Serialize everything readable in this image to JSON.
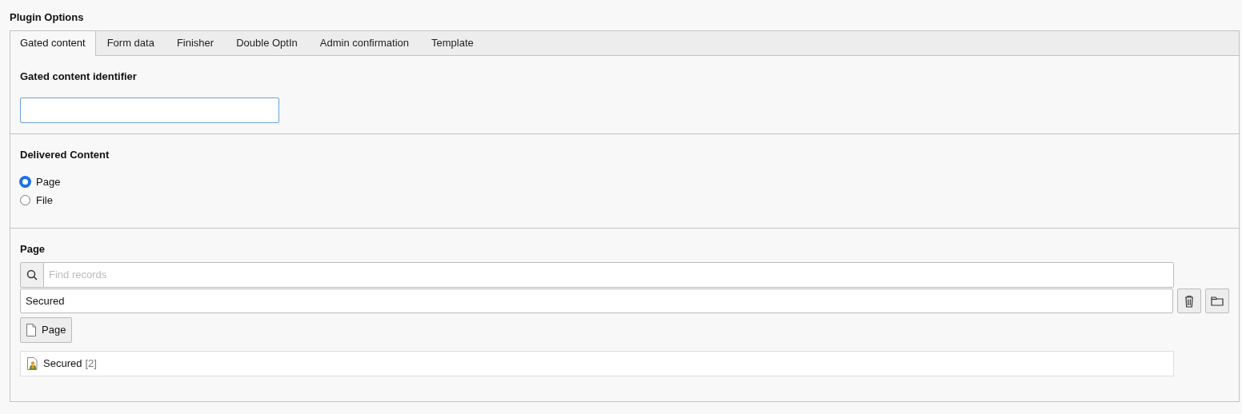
{
  "title": "Plugin Options",
  "tabs": [
    {
      "label": "Gated content",
      "selected": true
    },
    {
      "label": "Form data",
      "selected": false
    },
    {
      "label": "Finisher",
      "selected": false
    },
    {
      "label": "Double OptIn",
      "selected": false
    },
    {
      "label": "Admin confirmation",
      "selected": false
    },
    {
      "label": "Template",
      "selected": false
    }
  ],
  "identifier": {
    "label": "Gated content identifier"
  },
  "delivered_content": {
    "label": "Delivered Content",
    "options": [
      {
        "label": "Page",
        "selected": true
      },
      {
        "label": "File",
        "selected": false
      }
    ]
  },
  "page": {
    "label": "Page",
    "search": {
      "placeholder": "Find records"
    },
    "selected_items": [
      "Secured"
    ],
    "add_button": "Page",
    "records": [
      {
        "title": "Secured",
        "id": "[2]"
      }
    ]
  }
}
